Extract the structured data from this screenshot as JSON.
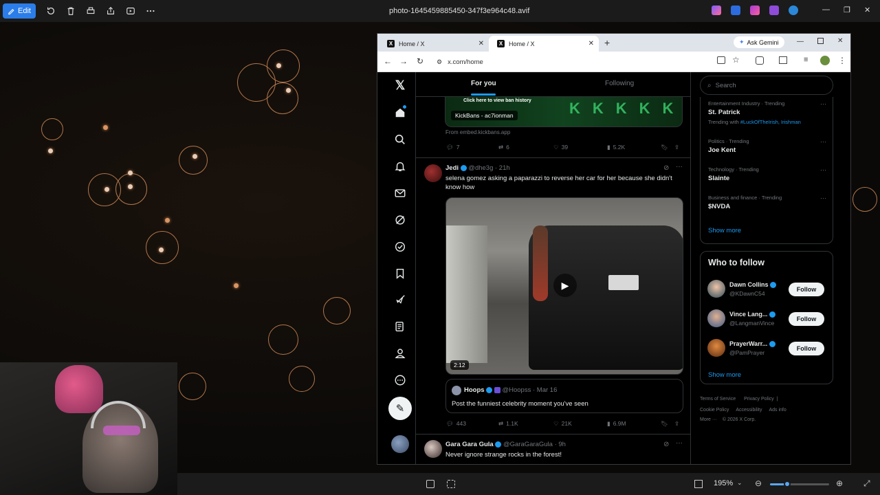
{
  "photos_app": {
    "edit_label": "Edit",
    "file_title": "photo-1645459885450-347f3e964c48.avif",
    "zoom": "195%"
  },
  "browser": {
    "tabs": [
      {
        "title": "Home / X"
      },
      {
        "title": "Home / X"
      }
    ],
    "ask_gemini": "Ask Gemini",
    "url": "x.com/home"
  },
  "x": {
    "tabs": {
      "for_you": "For you",
      "following": "Following"
    },
    "top_embed": {
      "link_text": "Click here to view ban history",
      "card_title": "KickBans - ac7ionman",
      "source": "From embed.kickbans.app",
      "stats": {
        "replies": "7",
        "reposts": "6",
        "likes": "39",
        "views": "5.2K"
      }
    },
    "post1": {
      "name": "Jedi",
      "handle": "@dhe3g",
      "time": "· 21h",
      "text": "selena gomez asking a paparazzi to reverse her car for her because she didn't know how",
      "video_duration": "2:12",
      "quote": {
        "name": "Hoops",
        "handle": "@Hoopss",
        "time": "· Mar 16",
        "text": "Post the funniest celebrity moment you've seen"
      },
      "stats": {
        "replies": "443",
        "reposts": "1.1K",
        "likes": "21K",
        "views": "6.9M"
      }
    },
    "post2": {
      "name": "Gara Gara Gula",
      "handle": "@GaraGaraGula",
      "time": "· 9h",
      "text": "Never ignore strange rocks in the forest!"
    },
    "search_placeholder": "Search",
    "trends": [
      {
        "category": "Entertainment Industry · Trending",
        "name": "St. Patrick",
        "extra_prefix": "Trending with",
        "extra_links": "#LuckOfTheIrish, Irishman"
      },
      {
        "category": "Politics · Trending",
        "name": "Joe Kent"
      },
      {
        "category": "Technology · Trending",
        "name": "Slainte"
      },
      {
        "category": "Business and finance · Trending",
        "name": "$NVDA"
      }
    ],
    "show_more": "Show more",
    "who_to_follow": {
      "title": "Who to follow",
      "accounts": [
        {
          "name": "Dawn Collins",
          "handle": "@KDawnC54",
          "button": "Follow"
        },
        {
          "name": "Vince Lang...",
          "handle": "@LangmanVince",
          "button": "Follow"
        },
        {
          "name": "PrayerWarr...",
          "handle": "@PamPrayer",
          "button": "Follow"
        }
      ],
      "show_more": "Show more"
    },
    "footer": {
      "line1": [
        "Terms of Service",
        "Privacy Policy",
        "Cookie Policy",
        "Accessibility",
        "Ads info"
      ],
      "more": "More ···",
      "copyright": "© 2026 X Corp."
    }
  },
  "colors": {
    "accent": "#1d9bf0",
    "edit_button": "#2b7de9",
    "bokeh": "#b3774b"
  }
}
